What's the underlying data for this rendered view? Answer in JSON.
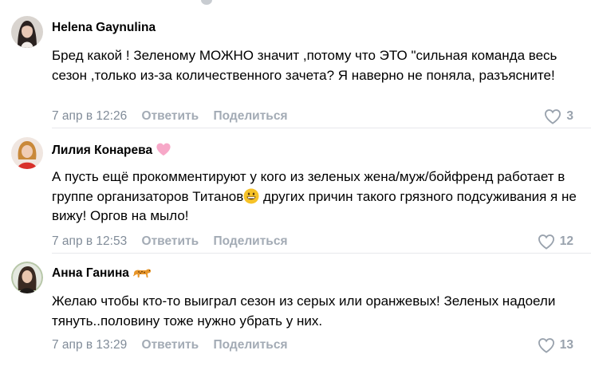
{
  "comments": [
    {
      "author": "Helena Gaynulina",
      "text": "Бред какой ! Зеленому МОЖНО значит ,потому что ЭТО \"сильная команда весь сезон ,только из-за количественного зачета? Я наверно не поняла, разъясните!",
      "date": "7 апр в 12:26",
      "reply_label": "Ответить",
      "share_label": "Поделиться",
      "likes": "3"
    },
    {
      "author": "Лилия Конарева",
      "author_emoji": "pink-heart-icon",
      "text_before_emoji": "А пусть ещё прокомментируют у кого из зеленых жена/муж/бойфренд работает в группе организаторов Титанов",
      "inline_emoji": "grinning-face-icon",
      "text_after_emoji": " других причин такого грязного подсуживания я не вижу! Оргов на мыло!",
      "date": "7 апр в 12:53",
      "reply_label": "Ответить",
      "share_label": "Поделиться",
      "likes": "12"
    },
    {
      "author": "Анна Ганина",
      "author_emoji": "leopard-icon",
      "text": "Желаю чтобы кто-то выиграл сезон из серых или оранжевых! Зеленых надоели тянуть..половину тоже нужно убрать у них.",
      "date": "7 апр в 13:29",
      "reply_label": "Ответить",
      "share_label": "Поделиться",
      "likes": "13"
    }
  ],
  "colors": {
    "meta_text": "#818c99",
    "action_text": "#a3abb5",
    "like_icon": "#99a2ad",
    "divider": "#e7e8ec"
  }
}
